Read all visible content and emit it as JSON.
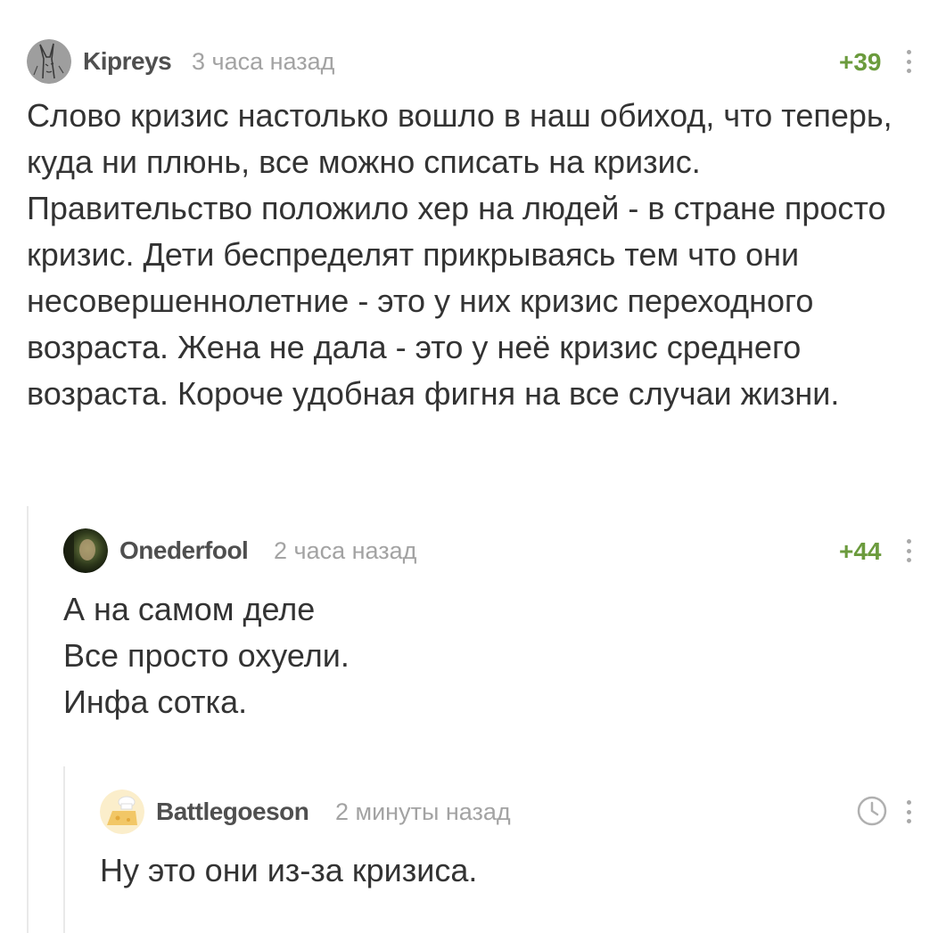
{
  "comments": [
    {
      "author": "Kipreys",
      "time": "3 часа назад",
      "rating": "+39",
      "text": "Слово кризис настолько вошло в наш обиход, что теперь, куда ни плюнь, все можно списать на кризис. Правительство положило хер на людей - в стране просто кризис. Дети беспределят прикрываясь тем что они несовершеннолетние - это у них кризис переходного возраста. Жена не дала - это у неё кризис среднего возраста. Короче удобная фигня на все случаи жизни.",
      "avatar_icon": "rabbit-sketch-avatar"
    },
    {
      "author": "Onederfool",
      "time": "2 часа назад",
      "rating": "+44",
      "text": "А на самом деле\nВсе просто охуели.\nИнфа сотка.",
      "avatar_icon": "movie-still-avatar"
    },
    {
      "author": "Battlegoeson",
      "time": "2 минуты назад",
      "text": "Ну это они из-за кризиса.",
      "avatar_icon": "cheese-chef-avatar",
      "status_icon": "clock-icon"
    }
  ],
  "colors": {
    "rating": "#6b9b3d",
    "author": "#4f4f4f",
    "muted": "#a3a3a3",
    "thread_line": "#e9e9e9"
  }
}
